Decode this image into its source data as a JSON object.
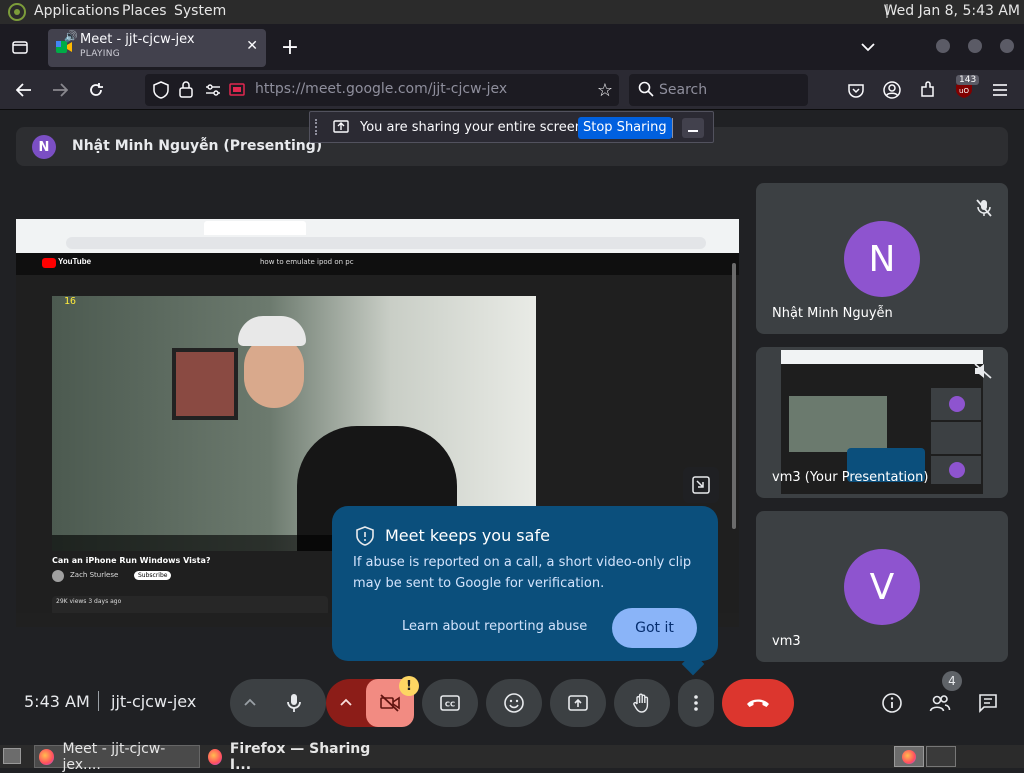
{
  "top_panel": {
    "menus": [
      "Applications",
      "Places",
      "System"
    ],
    "clock": "Wed Jan  8,  5:43 AM"
  },
  "browser": {
    "tab": {
      "title": "Meet - jjt-cjcw-jex",
      "status": "PLAYING"
    },
    "url_host": "https://meet.google.com",
    "url_path": "/jjt-cjcw-jex",
    "search_placeholder": "Search",
    "extension_badge": "143"
  },
  "share_bar": {
    "message": "You are sharing your entire screen.",
    "stop_label": "Stop Sharing"
  },
  "presenter_bar": {
    "initial": "N",
    "label": "Nhật Minh Nguyễn (Presenting)"
  },
  "presentation": {
    "yt_search": "how to emulate ipod on pc",
    "video_title": "Can an iPhone Run Windows Vista?",
    "channel": "Zach Sturlese",
    "subscribe": "Subscribe",
    "frame_counter": "16",
    "views": "29K views  3 days ago"
  },
  "participants": [
    {
      "initial": "N",
      "name": "Nhật Minh Nguyễn"
    },
    {
      "initial": "",
      "name": "vm3 (Your Presentation)"
    },
    {
      "initial": "V",
      "name": "vm3"
    }
  ],
  "popup": {
    "title": "Meet keeps you safe",
    "body": "If abuse is reported on a call, a short video-only clip may be sent to Google for verification.",
    "learn_label": "Learn about reporting abuse",
    "got_it_label": "Got it"
  },
  "bottom": {
    "time": "5:43 AM",
    "meeting_code": "jjt-cjcw-jex",
    "people_count": "4",
    "camera_warning": "!"
  },
  "taskbar": {
    "tasks": [
      "Meet - jjt-cjcw-jex....",
      "Firefox — Sharing I..."
    ]
  },
  "colors": {
    "meet_bg": "#202124",
    "popup_bg": "#0b4f7c",
    "got_it_bg": "#8ab4f8",
    "end_call_red": "#e94235",
    "camera_off_pink": "#f28b82",
    "avatar_purple": "#8e54cf",
    "share_blue": "#0060df"
  }
}
